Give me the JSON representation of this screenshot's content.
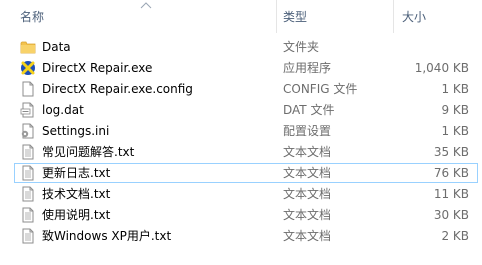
{
  "columns": {
    "name": "名称",
    "type": "类型",
    "size": "大小"
  },
  "files": [
    {
      "name": "Data",
      "type": "文件夹",
      "size": "",
      "icon": "folder-icon"
    },
    {
      "name": "DirectX Repair.exe",
      "type": "应用程序",
      "size": "1,040 KB",
      "icon": "directx-app-icon"
    },
    {
      "name": "DirectX Repair.exe.config",
      "type": "CONFIG 文件",
      "size": "1 KB",
      "icon": "file-icon"
    },
    {
      "name": "log.dat",
      "type": "DAT 文件",
      "size": "9 KB",
      "icon": "dat-file-icon"
    },
    {
      "name": "Settings.ini",
      "type": "配置设置",
      "size": "1 KB",
      "icon": "settings-file-icon"
    },
    {
      "name": "常见问题解答.txt",
      "type": "文本文档",
      "size": "35 KB",
      "icon": "text-file-icon"
    },
    {
      "name": "更新日志.txt",
      "type": "文本文档",
      "size": "76 KB",
      "icon": "text-file-icon"
    },
    {
      "name": "技术文档.txt",
      "type": "文本文档",
      "size": "11 KB",
      "icon": "text-file-icon"
    },
    {
      "name": "使用说明.txt",
      "type": "文本文档",
      "size": "30 KB",
      "icon": "text-file-icon"
    },
    {
      "name": "致Windows XP用户.txt",
      "type": "文本文档",
      "size": "2 KB",
      "icon": "text-file-icon"
    }
  ],
  "selected_index": 6,
  "colors": {
    "header_text": "#4c607a",
    "secondary_text": "#6d6d6d",
    "selection_border": "#99d1ff",
    "folder": "#e8b94a"
  }
}
